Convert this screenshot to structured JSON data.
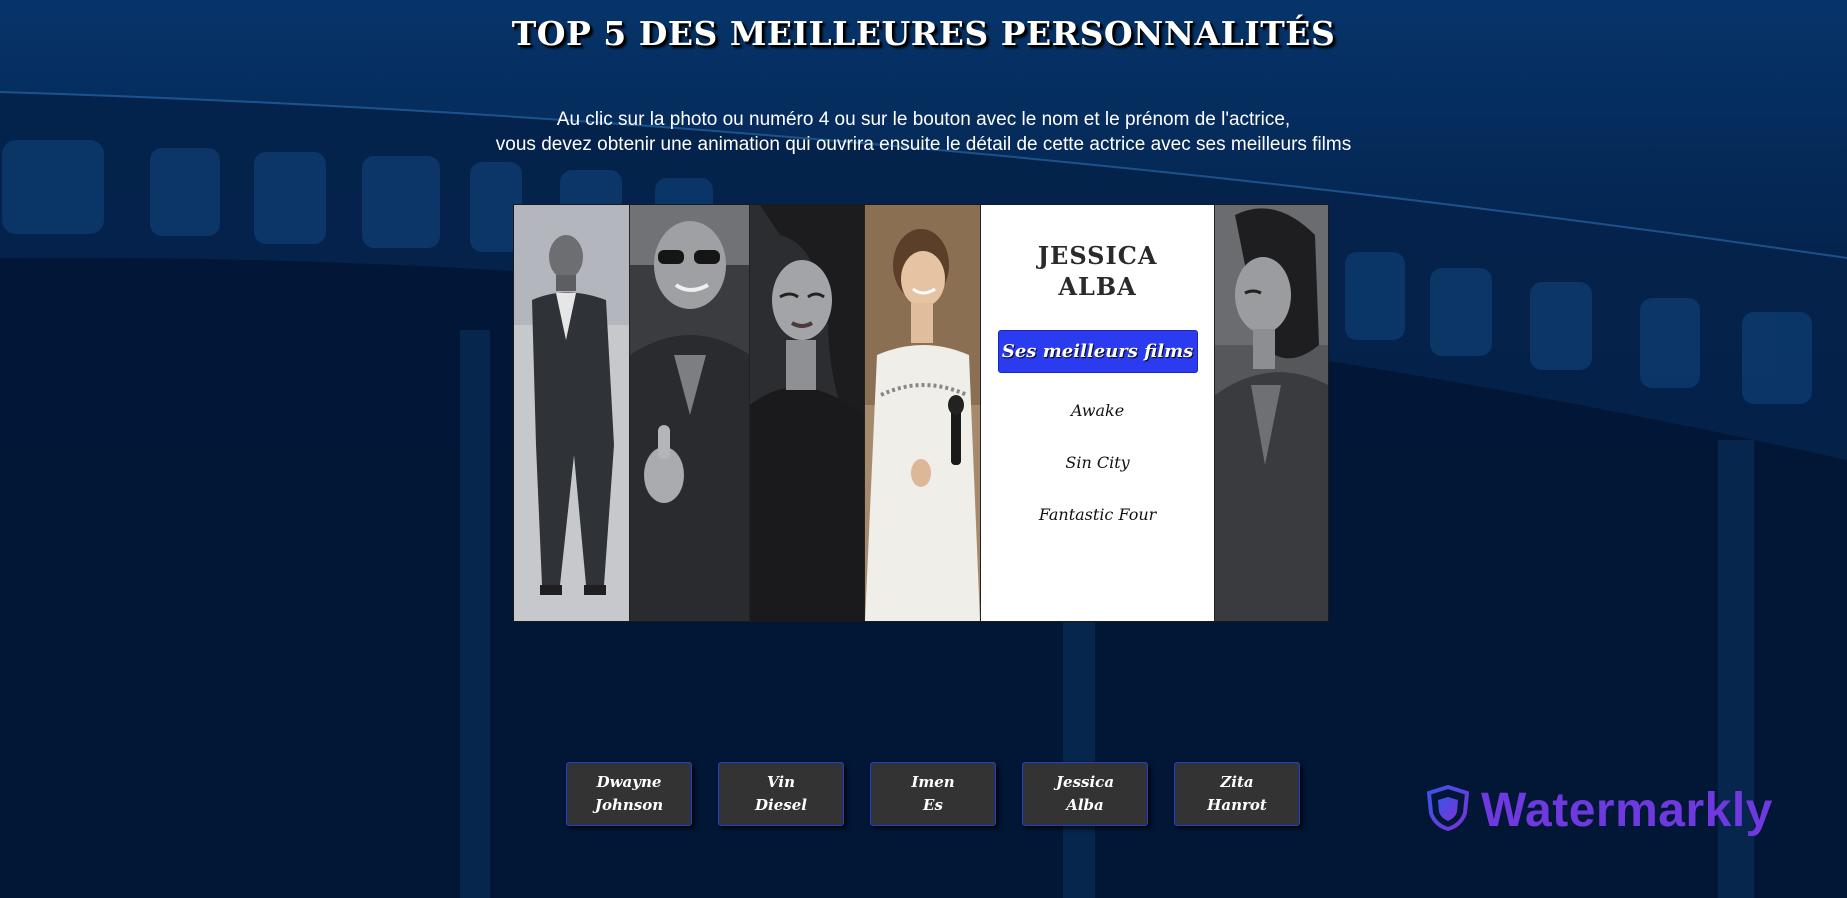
{
  "page": {
    "title": "TOP 5 DES MEILLEURES PERSONNALITÉS",
    "instructions": [
      "Au clic sur la photo ou numéro 4 ou sur le bouton avec le nom et le prénom de l'actrice,",
      "vous devez obtenir une animation qui ouvrira ensuite le détail de cette actrice avec ses meilleurs films"
    ]
  },
  "detail": {
    "name_line1": "JESSICA",
    "name_line2": "ALBA",
    "films_button_label": "Ses meilleurs films",
    "films": [
      "Awake",
      "Sin City",
      "Fantastic Four"
    ]
  },
  "name_buttons": [
    {
      "first": "Dwayne",
      "last": "Johnson"
    },
    {
      "first": "Vin",
      "last": "Diesel"
    },
    {
      "first": "Imen",
      "last": "Es"
    },
    {
      "first": "Jessica",
      "last": "Alba"
    },
    {
      "first": "Zita",
      "last": "Hanrot"
    }
  ],
  "watermark": {
    "text": "Watermarkly"
  },
  "colors": {
    "accent_button": "#2b3cf0",
    "name_button_bg": "#333333",
    "name_button_border": "#1f3fcf",
    "watermark": "#6f39e0"
  },
  "icons": {
    "watermark_logo": "shield-icon"
  }
}
